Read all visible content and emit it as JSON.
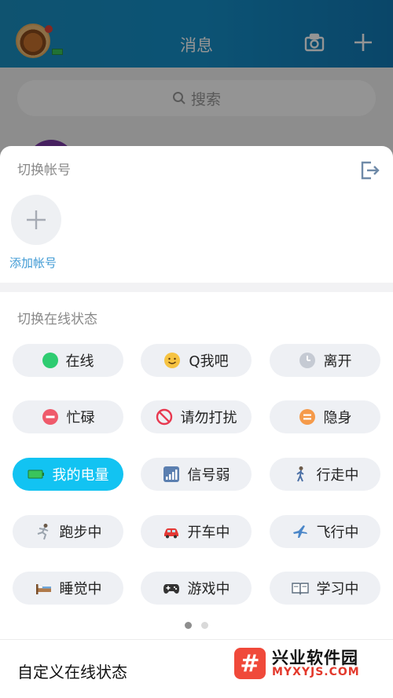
{
  "header": {
    "title": "消息"
  },
  "search": {
    "placeholder": "搜索"
  },
  "sheet": {
    "switch_account_label": "切换帐号",
    "add_account_label": "添加帐号",
    "switch_status_label": "切换在线状态",
    "statuses": [
      {
        "label": "在线",
        "icon": "online-dot-icon",
        "color": "#2ecc71",
        "active": false
      },
      {
        "label": "Q我吧",
        "icon": "smile-face-icon",
        "color": "#f6c342",
        "active": false
      },
      {
        "label": "离开",
        "icon": "clock-icon",
        "color": "#c5cad3",
        "active": false
      },
      {
        "label": "忙碌",
        "icon": "busy-minus-icon",
        "color": "#ef5a6b",
        "active": false
      },
      {
        "label": "请勿打扰",
        "icon": "no-entry-icon",
        "color": "#e8384f",
        "active": false
      },
      {
        "label": "隐身",
        "icon": "invisible-icon",
        "color": "#f59a4a",
        "active": false
      },
      {
        "label": "我的电量",
        "icon": "battery-icon",
        "color": "#3ac45b",
        "active": true
      },
      {
        "label": "信号弱",
        "icon": "signal-bars-icon",
        "color": "#5b7fb0",
        "active": false
      },
      {
        "label": "行走中",
        "icon": "walking-icon",
        "color": "#6b5a4a",
        "active": false
      },
      {
        "label": "跑步中",
        "icon": "running-icon",
        "color": "#6b5a4a",
        "active": false
      },
      {
        "label": "开车中",
        "icon": "car-icon",
        "color": "#e53935",
        "active": false
      },
      {
        "label": "飞行中",
        "icon": "airplane-icon",
        "color": "#4a86c8",
        "active": false
      },
      {
        "label": "睡觉中",
        "icon": "bed-icon",
        "color": "#b07a4a",
        "active": false
      },
      {
        "label": "游戏中",
        "icon": "gamepad-icon",
        "color": "#333333",
        "active": false
      },
      {
        "label": "学习中",
        "icon": "book-icon",
        "color": "#5d6d7e",
        "active": false
      }
    ],
    "custom_status_label": "自定义在线状态"
  },
  "watermark": {
    "title": "兴业软件园",
    "subtitle": "MYXYJS.COM",
    "logo_char": "#"
  },
  "colors": {
    "accent": "#12c3f2",
    "header": "#1590c9",
    "link": "#3f9ad4"
  }
}
